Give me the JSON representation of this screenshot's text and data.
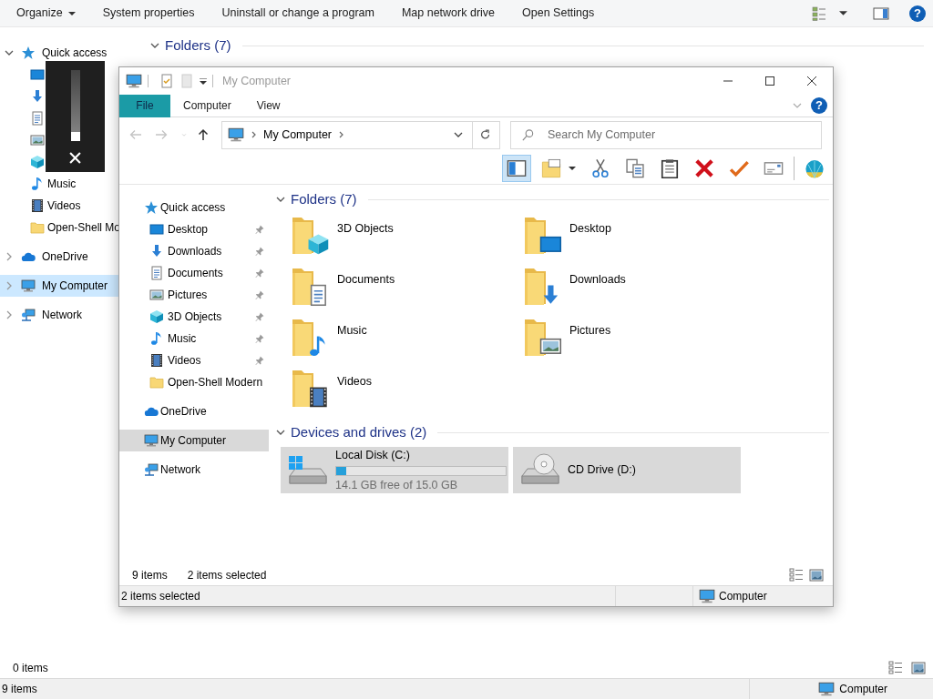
{
  "background_window": {
    "toolbar": [
      {
        "label": "Organize",
        "kind": "menu"
      },
      {
        "label": "System properties",
        "kind": "command"
      },
      {
        "label": "Uninstall or change a program",
        "kind": "command"
      },
      {
        "label": "Map network drive",
        "kind": "command"
      },
      {
        "label": "Open Settings",
        "kind": "command"
      }
    ],
    "help": "?",
    "nav": [
      {
        "label": "Quick access",
        "kind": "star",
        "expanded": true,
        "selected": false,
        "children": [
          {
            "kind": "desktop"
          },
          {
            "kind": "downloads"
          },
          {
            "kind": "documents"
          },
          {
            "kind": "pictures"
          },
          {
            "kind": "objects3d"
          },
          {
            "label": "Music",
            "kind": "music"
          },
          {
            "label": "Videos",
            "kind": "videos"
          },
          {
            "label": "Open-Shell Mo",
            "kind": "folder"
          }
        ]
      },
      {
        "label": "OneDrive",
        "kind": "onedrive",
        "expanded": false,
        "selected": false
      },
      {
        "label": "My Computer",
        "kind": "pc",
        "expanded": false,
        "selected": true
      },
      {
        "label": "Network",
        "kind": "network",
        "expanded": false,
        "selected": false
      }
    ],
    "section": {
      "title": "Folders (7)",
      "expanded": true
    },
    "item_count": "0 items",
    "status_bar": {
      "items": "9 items",
      "location": "Computer"
    }
  },
  "volume_popup": {
    "level": 0
  },
  "window": {
    "title": "My Computer",
    "ribbon_tabs": [
      {
        "label": "File",
        "kind": "file-menu"
      },
      {
        "label": "Computer",
        "kind": "tab"
      },
      {
        "label": "View",
        "kind": "tab"
      }
    ],
    "help": "?",
    "nav_buttons": [
      {
        "kind": "back",
        "disabled": true
      },
      {
        "kind": "forward",
        "disabled": true
      },
      {
        "kind": "recent",
        "disabled": true
      },
      {
        "kind": "up",
        "disabled": false
      }
    ],
    "address": {
      "crumbs": [
        "My Computer"
      ]
    },
    "search": {
      "placeholder": "Search My Computer"
    },
    "toolbar": [
      {
        "kind": "preview-pane",
        "on": true
      },
      {
        "kind": "new-folder",
        "on": false
      },
      {
        "kind": "cut",
        "on": false
      },
      {
        "kind": "copy",
        "on": false
      },
      {
        "kind": "paste",
        "on": false
      },
      {
        "kind": "delete",
        "on": false
      },
      {
        "kind": "properties",
        "on": false
      },
      {
        "kind": "email",
        "on": false
      },
      {
        "kind": "shell",
        "on": false
      }
    ],
    "nav": [
      {
        "label": "Quick access",
        "kind": "star",
        "selected": false,
        "children": [
          {
            "label": "Desktop",
            "kind": "desktop",
            "pinned": true,
            "selected": false
          },
          {
            "label": "Downloads",
            "kind": "downloads",
            "pinned": true,
            "selected": false
          },
          {
            "label": "Documents",
            "kind": "documents",
            "pinned": true,
            "selected": false
          },
          {
            "label": "Pictures",
            "kind": "pictures",
            "pinned": true,
            "selected": false
          },
          {
            "label": "3D Objects",
            "kind": "objects3d",
            "pinned": true,
            "selected": false
          },
          {
            "label": "Music",
            "kind": "music",
            "pinned": true,
            "selected": false
          },
          {
            "label": "Videos",
            "kind": "videos",
            "pinned": true,
            "selected": false
          },
          {
            "label": "Open-Shell Modern",
            "kind": "folder",
            "pinned": false,
            "selected": false
          }
        ]
      },
      {
        "label": "OneDrive",
        "kind": "onedrive",
        "selected": false
      },
      {
        "label": "My Computer",
        "kind": "pc",
        "selected": true
      },
      {
        "label": "Network",
        "kind": "network",
        "selected": false
      }
    ],
    "groups": [
      {
        "title": "Folders (7)",
        "kind": "folders",
        "expanded": true,
        "items": [
          {
            "label": "3D Objects",
            "kind": "objects3d"
          },
          {
            "label": "Desktop",
            "kind": "desktop"
          },
          {
            "label": "Documents",
            "kind": "documents"
          },
          {
            "label": "Downloads",
            "kind": "downloads"
          },
          {
            "label": "Music",
            "kind": "music"
          },
          {
            "label": "Pictures",
            "kind": "pictures"
          },
          {
            "label": "Videos",
            "kind": "videos"
          }
        ]
      },
      {
        "title": "Devices and drives (2)",
        "kind": "drives",
        "expanded": true,
        "items": [
          {
            "label": "Local Disk (C:)",
            "kind": "hdd",
            "selected": true,
            "level": 0.06,
            "free": "14.1 GB free of 15.0 GB"
          },
          {
            "label": "CD Drive (D:)",
            "kind": "cd",
            "selected": true
          }
        ]
      }
    ],
    "footer": {
      "count": "9 items",
      "selection": "2 items selected"
    },
    "status_bar": {
      "selection": "2 items selected",
      "location": "Computer"
    }
  }
}
